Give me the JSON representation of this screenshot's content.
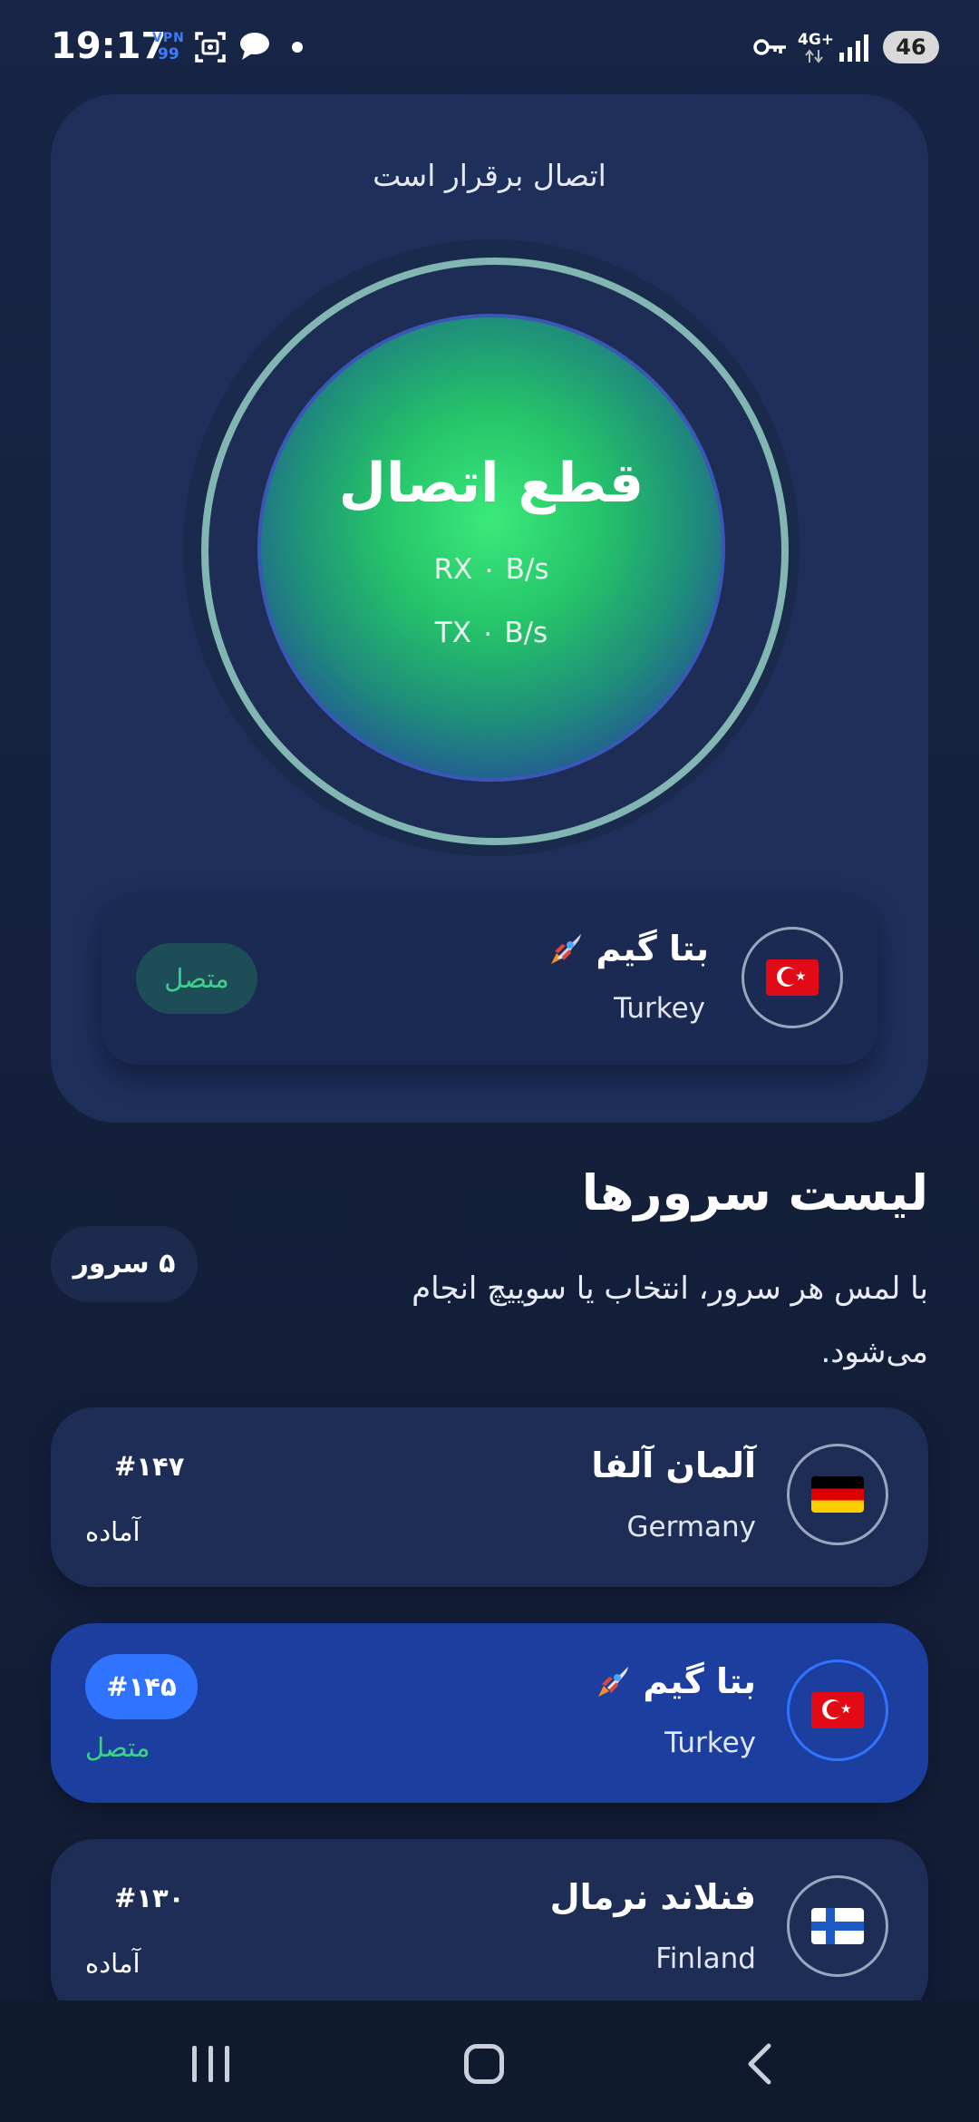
{
  "status_bar": {
    "time": "19:17",
    "vpn_top": "VPN",
    "vpn_bottom": "99",
    "network": "4G+",
    "battery": "46"
  },
  "connection": {
    "status": "اتصال برقرار است",
    "disconnect_label": "قطع اتصال",
    "rx": "RX ۰ B/s",
    "tx": "TX ۰ B/s"
  },
  "current_server": {
    "name": "بتا گیم",
    "country": "Turkey",
    "flag_icon": "turkey-flag-icon",
    "badge": "متصل"
  },
  "server_list": {
    "title": "لیست سرورها",
    "count": "۵ سرور",
    "subtitle": "با لمس هر سرور، انتخاب یا سوییچ انجام می‌شود.",
    "items": [
      {
        "name": "آلمان آلفا",
        "country": "Germany",
        "number": "#۱۴۷",
        "state": "آماده",
        "flag_icon": "germany-flag-icon",
        "active": false
      },
      {
        "name": "بتا گیم",
        "country": "Turkey",
        "number": "#۱۴۵",
        "state": "متصل",
        "flag_icon": "turkey-flag-icon",
        "active": true
      },
      {
        "name": "فنلاند نرمال",
        "country": "Finland",
        "number": "#۱۳۰",
        "state": "آماده",
        "flag_icon": "finland-flag-icon",
        "active": false
      }
    ]
  },
  "colors": {
    "background": "#14213d",
    "card": "#1f2f5c",
    "active_item": "#1c3f9f",
    "accent_blue": "#2f73ff",
    "connected_green": "#3ed08a",
    "orb_green": "#3bea7a"
  }
}
